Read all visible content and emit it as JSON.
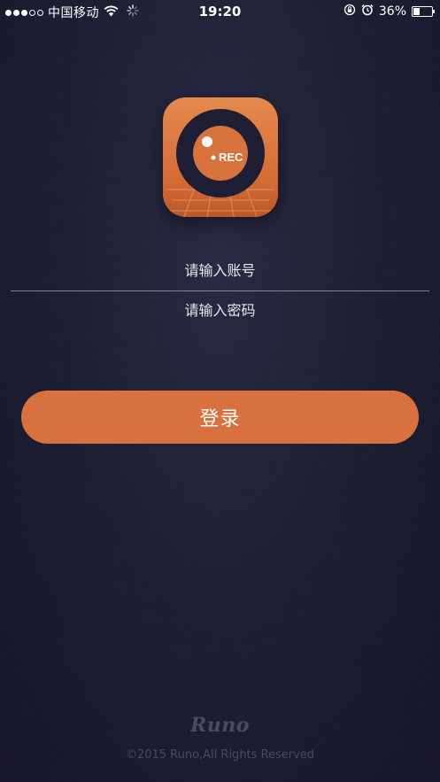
{
  "status_bar": {
    "signal_strength": "3/5",
    "carrier": "中国移动",
    "time": "19:20",
    "battery_percent_label": "36%",
    "battery_level": 0.36,
    "icons": [
      "wifi-icon",
      "activity-spinner-icon",
      "orientation-lock-icon",
      "alarm-icon",
      "battery-icon"
    ]
  },
  "app_icon": {
    "badge_text": "REC",
    "colors": {
      "primary": "#e0793f",
      "dark": "#1e1e34"
    }
  },
  "login_form": {
    "account_placeholder": "请输入账号",
    "password_placeholder": "请输入密码",
    "login_label": "登录",
    "accent_color": "#d8703f"
  },
  "footer": {
    "brand": "Runo",
    "copyright": "©2015 Runo,All Rights Reserved"
  }
}
